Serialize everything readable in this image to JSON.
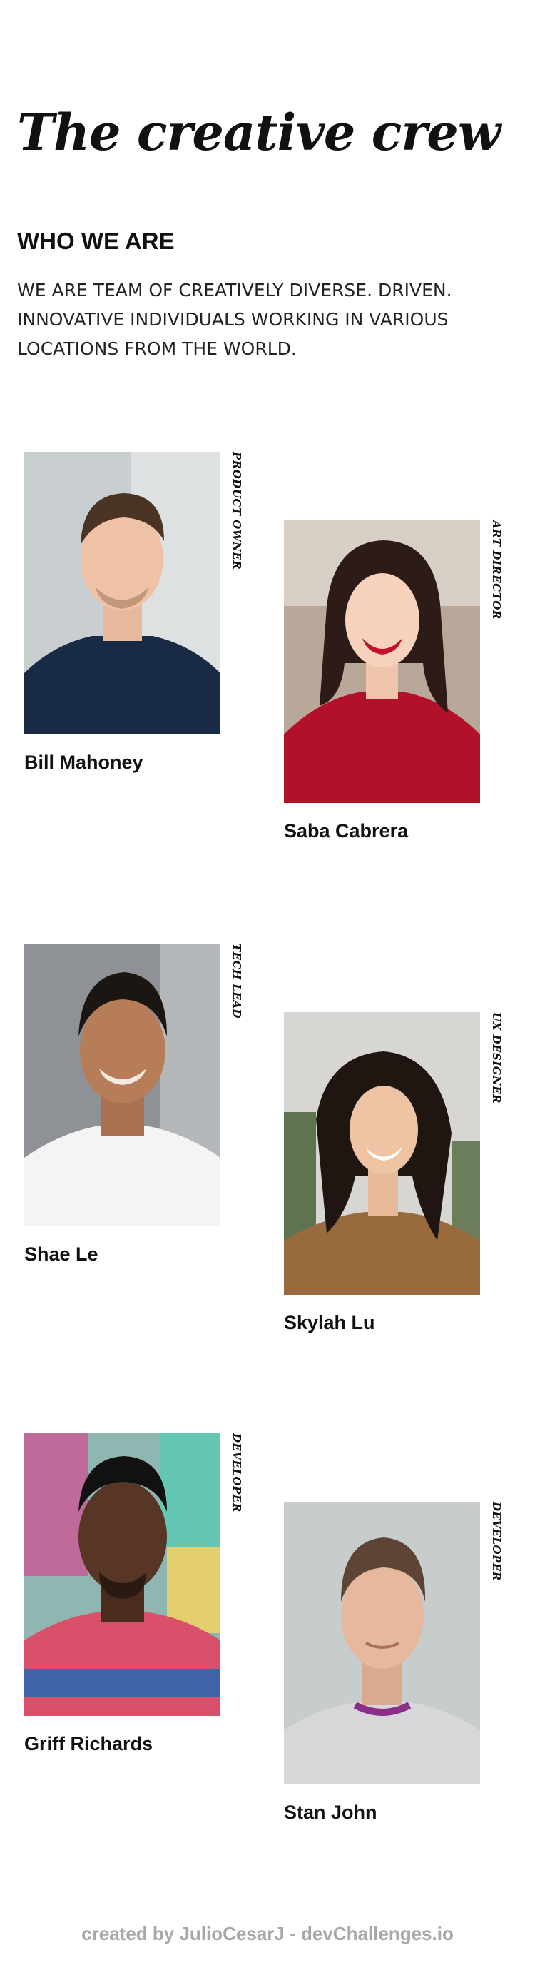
{
  "header": {
    "title": "The creative crew"
  },
  "intro": {
    "heading": "WHO WE ARE",
    "text": "WE ARE TEAM OF CREATIVELY DIVERSE. DRIVEN. INNOVATIVE INDIVIDUALS WORKING IN VARIOUS LOCATIONS FROM THE WORLD."
  },
  "team": {
    "members": [
      {
        "name": "Bill Mahoney",
        "role": "PRODUCT OWNER"
      },
      {
        "name": "Saba Cabrera",
        "role": "ART DIRECTOR"
      },
      {
        "name": "Shae Le",
        "role": "TECH LEAD"
      },
      {
        "name": "Skylah Lu",
        "role": "UX DESIGNER"
      },
      {
        "name": "Griff Richards",
        "role": "DEVELOPER"
      },
      {
        "name": "Stan John",
        "role": "DEVELOPER"
      }
    ]
  },
  "footer": {
    "prefix": "created by",
    "author": "JulioCesarJ",
    "separator": " - ",
    "site": "devChallenges.io"
  }
}
